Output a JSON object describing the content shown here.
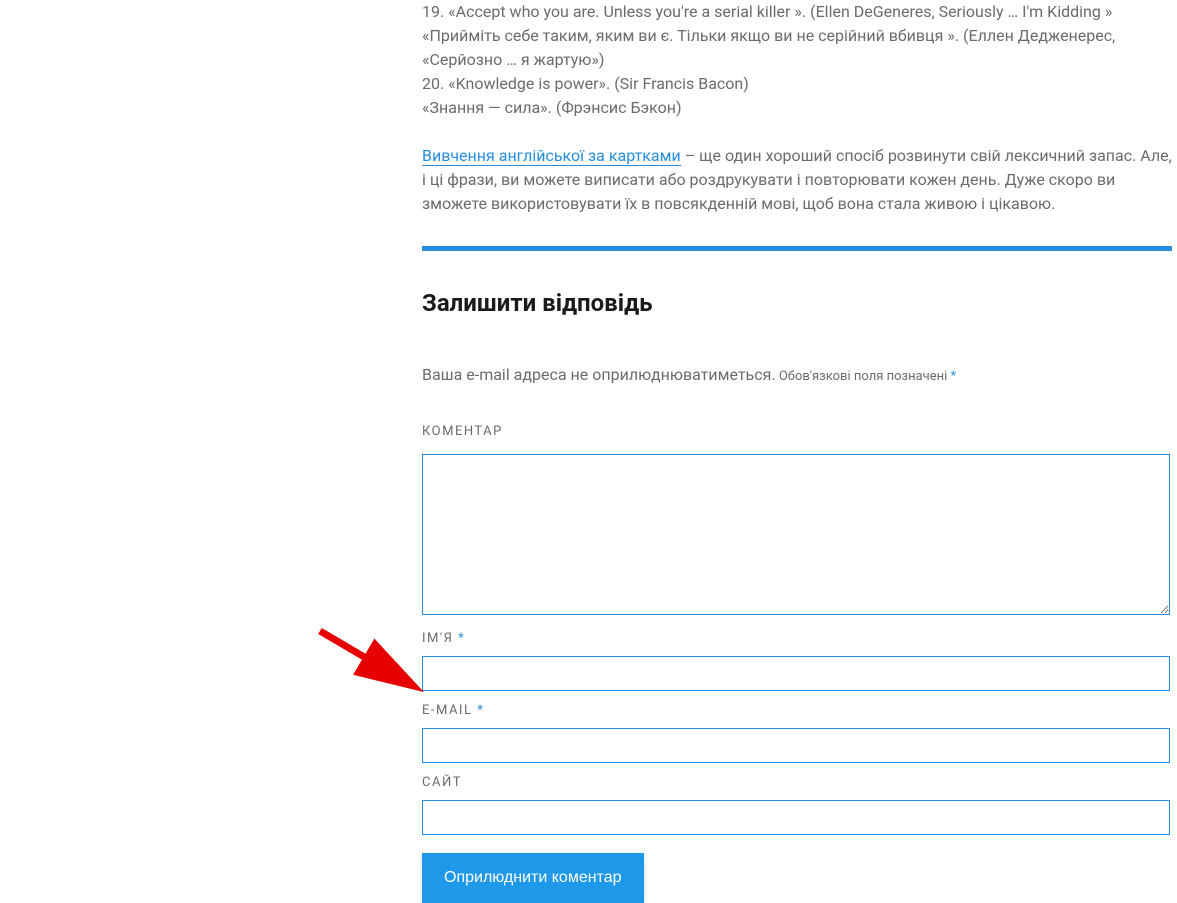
{
  "article": {
    "line1": "19. «Accept who you are. Unless you're a serial killer ». (Ellen DeGeneres, Seriously … I'm Kidding »",
    "line2": "«Прийміть себе таким, яким ви є. Тільки якщо ви не серійний вбивця ». (Еллен Дедженерес, «Серйозно … я жартую»)",
    "line3": "20. «Knowledge is power». (Sir Francis Bacon)",
    "line4": "«Знання — сила». (Фрэнсис Бэкон)"
  },
  "link_paragraph": {
    "link_text": "Вивчення англійської за картками",
    "rest_text": " – ще один хороший спосіб розвинути свій лексичний запас. Але, і ці фрази, ви можете виписати або роздрукувати і повторювати кожен день. Дуже скоро ви зможете використовувати їх в повсякденній мові, щоб вона стала живою і цікавою."
  },
  "reply": {
    "heading": "Залишити відповідь",
    "notice_main": "Ваша e-mail адреса не оприлюднюватиметься.",
    "notice_small": " Обов'язкові поля позначені ",
    "star": "*"
  },
  "labels": {
    "comment": "КОМЕНТАР",
    "name": "ІМ'Я",
    "email": "E-MAIL",
    "site": "САЙТ"
  },
  "button": {
    "submit": "Оприлюднити коментар"
  }
}
